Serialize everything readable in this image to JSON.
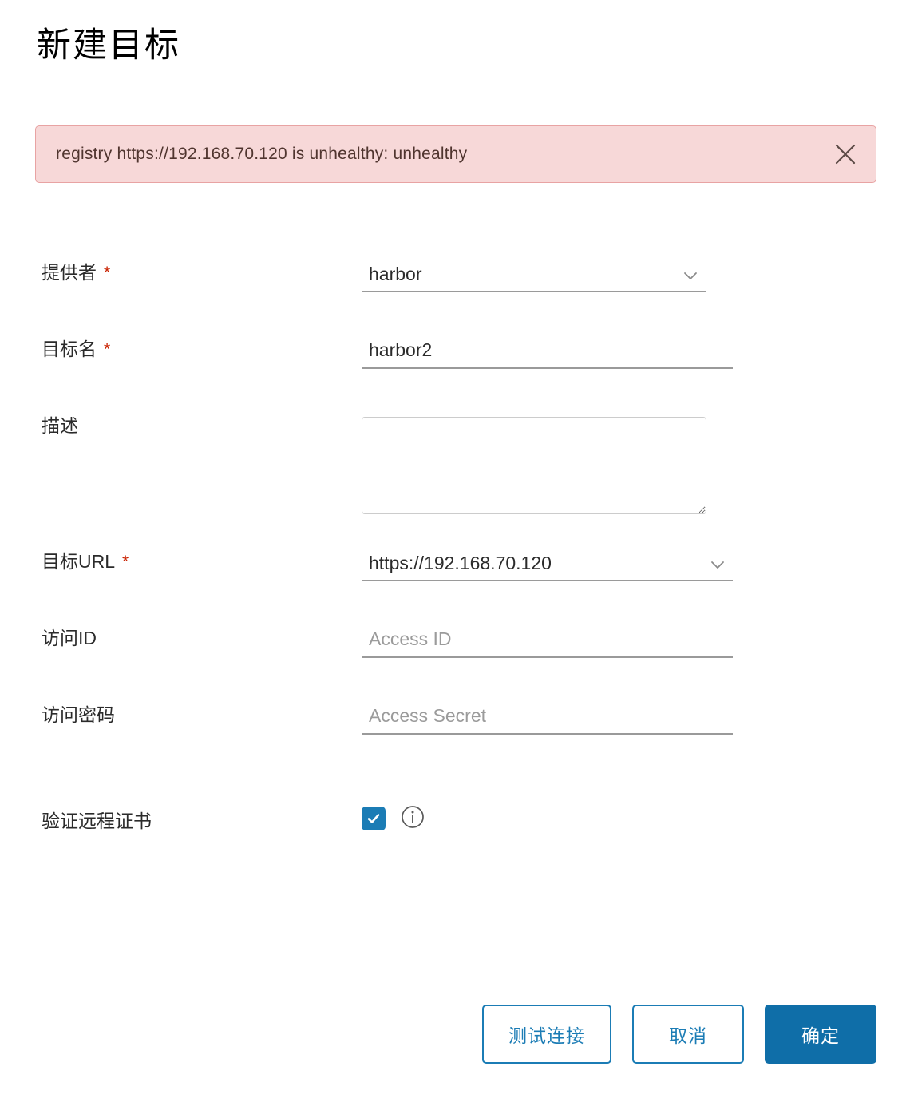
{
  "page": {
    "title": "新建目标"
  },
  "alert": {
    "message": "registry https://192.168.70.120 is unhealthy: unhealthy",
    "close_label": "关闭",
    "background_color": "#f7d8d8",
    "border_color": "#e8a3a3",
    "text_color": "#50352f"
  },
  "form": {
    "provider": {
      "label": "提供者",
      "required_mark": "*",
      "value": "harbor"
    },
    "target_name": {
      "label": "目标名",
      "required_mark": "*",
      "value": "harbor2",
      "placeholder": ""
    },
    "description": {
      "label": "描述",
      "value": "",
      "placeholder": ""
    },
    "target_url": {
      "label": "目标URL",
      "required_mark": "*",
      "value": "https://192.168.70.120"
    },
    "access_id": {
      "label": "访问ID",
      "value": "",
      "placeholder": "Access ID"
    },
    "access_secret": {
      "label": "访问密码",
      "value": "",
      "placeholder": "Access Secret"
    },
    "verify_cert": {
      "label": "验证远程证书",
      "checked": true,
      "checkbox_color": "#1b7cb5",
      "info_icon": "info-circle-icon"
    }
  },
  "footer": {
    "test_connection_label": "测试连接",
    "cancel_label": "取消",
    "confirm_label": "确定",
    "accent_color": "#1b7cb5",
    "primary_color": "#0f6ea8"
  }
}
